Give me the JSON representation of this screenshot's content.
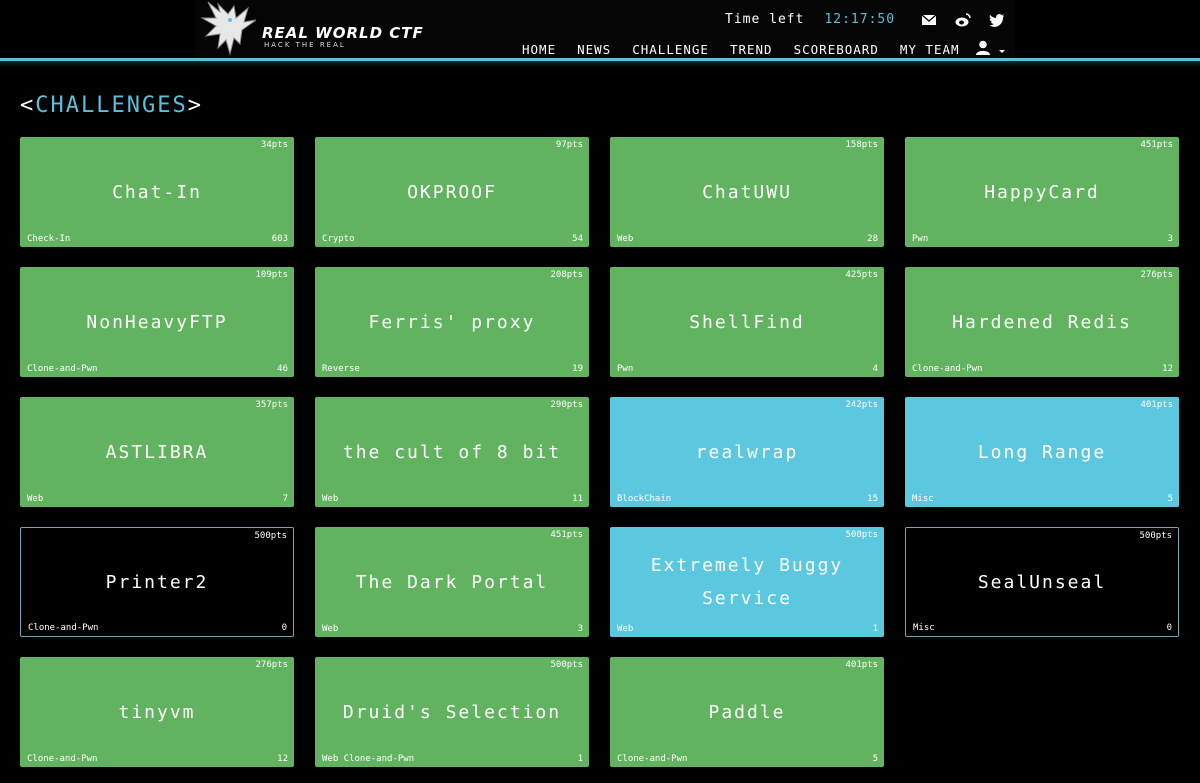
{
  "brand": {
    "name": "REAL WORLD CTF",
    "tagline": "HACK THE REAL"
  },
  "timer": {
    "label": "Time left",
    "value": "12:17:50"
  },
  "social_icons": [
    "mail-icon",
    "weibo-icon",
    "twitter-icon"
  ],
  "nav": [
    "HOME",
    "NEWS",
    "CHALLENGE",
    "TREND",
    "SCOREBOARD",
    "MY TEAM"
  ],
  "user_menu_icon": "user-icon",
  "page_title": {
    "open": "<",
    "text": "CHALLENGES",
    "close": ">"
  },
  "colors": {
    "accent": "#5bc0de",
    "unsolved": "#62b35f",
    "solved": "#5bc8e0",
    "unsolved_zero": "#000000"
  },
  "challenges": [
    {
      "name": "Chat-In",
      "points": "34pts",
      "category": "Check-In",
      "solves": "603",
      "state": "green"
    },
    {
      "name": "OKPROOF",
      "points": "97pts",
      "category": "Crypto",
      "solves": "54",
      "state": "green"
    },
    {
      "name": "ChatUWU",
      "points": "158pts",
      "category": "Web",
      "solves": "28",
      "state": "green"
    },
    {
      "name": "HappyCard",
      "points": "451pts",
      "category": "Pwn",
      "solves": "3",
      "state": "green"
    },
    {
      "name": "NonHeavyFTP",
      "points": "109pts",
      "category": "Clone-and-Pwn",
      "solves": "46",
      "state": "green"
    },
    {
      "name": "Ferris' proxy",
      "points": "208pts",
      "category": "Reverse",
      "solves": "19",
      "state": "green"
    },
    {
      "name": "ShellFind",
      "points": "425pts",
      "category": "Pwn",
      "solves": "4",
      "state": "green"
    },
    {
      "name": "Hardened Redis",
      "points": "276pts",
      "category": "Clone-and-Pwn",
      "solves": "12",
      "state": "green"
    },
    {
      "name": "ASTLIBRA",
      "points": "357pts",
      "category": "Web",
      "solves": "7",
      "state": "green"
    },
    {
      "name": "the cult of 8 bit",
      "points": "290pts",
      "category": "Web",
      "solves": "11",
      "state": "green"
    },
    {
      "name": "realwrap",
      "points": "242pts",
      "category": "BlockChain",
      "solves": "15",
      "state": "blue"
    },
    {
      "name": "Long Range",
      "points": "401pts",
      "category": "Misc",
      "solves": "5",
      "state": "blue"
    },
    {
      "name": "Printer2",
      "points": "500pts",
      "category": "Clone-and-Pwn",
      "solves": "0",
      "state": "dark"
    },
    {
      "name": "The Dark Portal",
      "points": "451pts",
      "category": "Web",
      "solves": "3",
      "state": "green"
    },
    {
      "name": "Extremely Buggy Service",
      "points": "500pts",
      "category": "Web",
      "solves": "1",
      "state": "blue"
    },
    {
      "name": "SealUnseal",
      "points": "500pts",
      "category": "Misc",
      "solves": "0",
      "state": "dark"
    },
    {
      "name": "tinyvm",
      "points": "276pts",
      "category": "Clone-and-Pwn",
      "solves": "12",
      "state": "green"
    },
    {
      "name": "Druid's Selection",
      "points": "500pts",
      "category": "Web Clone-and-Pwn",
      "solves": "1",
      "state": "green"
    },
    {
      "name": "Paddle",
      "points": "401pts",
      "category": "Clone-and-Pwn",
      "solves": "5",
      "state": "green"
    }
  ]
}
